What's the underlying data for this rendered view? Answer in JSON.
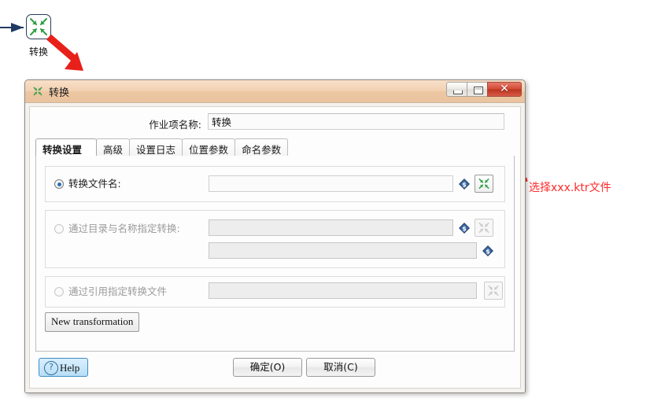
{
  "canvas": {
    "step": {
      "label": "转换",
      "icon": "transformation-converge-icon",
      "hop_icon": "hop-arrow-icon"
    },
    "annotations": [
      {
        "id": "arrow-to-dialog",
        "icon": "red-arrow-down-right-icon",
        "text": ""
      },
      {
        "id": "arrow-to-browse",
        "icon": "red-arrow-left-icon",
        "text": "选择xxx.ktr文件"
      }
    ]
  },
  "dialog": {
    "title": "转换",
    "title_icon": "transformation-converge-icon",
    "window_buttons": {
      "minimize": "minimize-icon",
      "maximize": "maximize-icon",
      "close": "close-icon",
      "close_glyph": "✕"
    },
    "name_field": {
      "label": "作业项名称:",
      "value": "转换",
      "placeholder": ""
    },
    "tabs": [
      {
        "label": "转换设置",
        "active": true
      },
      {
        "label": "高级",
        "active": false
      },
      {
        "label": "设置日志",
        "active": false
      },
      {
        "label": "位置参数",
        "active": false
      },
      {
        "label": "命名参数",
        "active": false
      }
    ],
    "options": [
      {
        "id": "by-filename",
        "label": "转换文件名:",
        "selected": true,
        "enabled": true,
        "fields": [
          {
            "value": "",
            "placeholder": "",
            "enabled": true,
            "variable_icon": "variable-diamond-icon",
            "browse_button": "browse-transformation-button"
          }
        ]
      },
      {
        "id": "by-directory-and-name",
        "label": "通过目录与名称指定转换:",
        "selected": false,
        "enabled": false,
        "fields": [
          {
            "value": "",
            "placeholder": "",
            "enabled": false,
            "variable_icon": "variable-diamond-icon",
            "browse_button": "browse-transformation-button"
          },
          {
            "value": "",
            "placeholder": "",
            "enabled": false,
            "variable_icon": "variable-diamond-icon",
            "browse_button": null
          }
        ]
      },
      {
        "id": "by-reference",
        "label": "通过引用指定转换文件",
        "selected": false,
        "enabled": false,
        "fields": [
          {
            "value": "",
            "placeholder": "",
            "enabled": false,
            "variable_icon": null,
            "browse_button": "browse-transformation-button"
          }
        ]
      }
    ],
    "new_transformation_button": "New transformation",
    "footer": {
      "help_label": "Help",
      "help_icon": "question-circle-icon",
      "ok_label": "确定(O)",
      "cancel_label": "取消(C)"
    }
  },
  "colors": {
    "annotation_red": "#ff2a2a",
    "titlebar": "#eec9a6",
    "close_button": "#c8452f",
    "radio_selected": "#2b6fb5",
    "icon_green": "#2f9e44",
    "variable_blue": "#2b4a7a",
    "help_border": "#3c8dc5"
  }
}
